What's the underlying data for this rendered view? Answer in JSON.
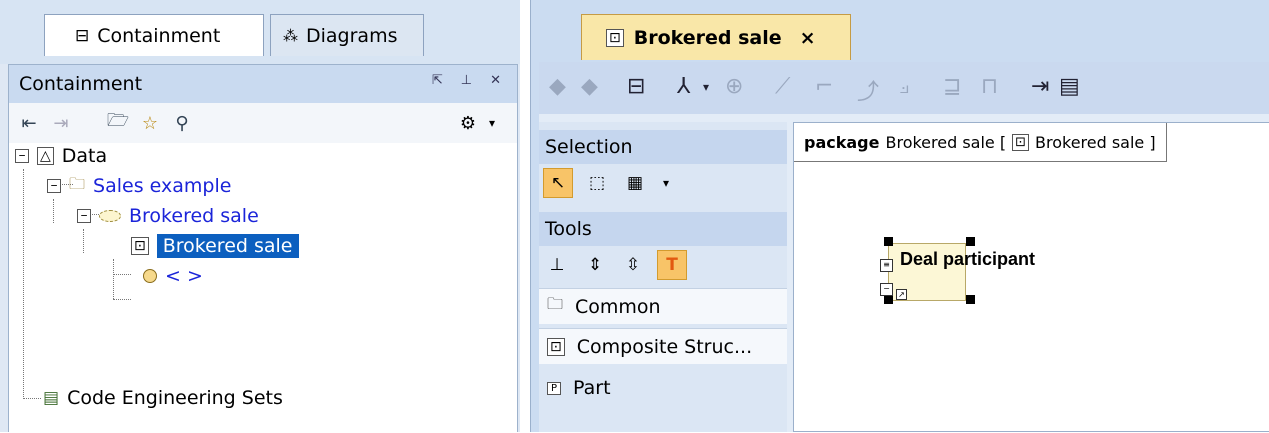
{
  "left_tabs": {
    "containment": "Containment",
    "diagrams": "Diagrams"
  },
  "panel": {
    "title": "Containment"
  },
  "tree": {
    "data": "Data",
    "sales_example": "Sales example",
    "brokered_sale_collab": "Brokered sale",
    "brokered_sale_diagram": "Brokered sale",
    "anonymous_item": "< >",
    "code_engineering_sets": "Code Engineering Sets"
  },
  "editor": {
    "tab_title": "Brokered sale",
    "close": "×"
  },
  "palette": {
    "selection": "Selection",
    "tools": "Tools",
    "common": "Common",
    "composite_structure": "Composite Struc...",
    "part": "Part"
  },
  "canvas": {
    "package_keyword": "package",
    "package_name": "Brokered sale [",
    "package_context": "Brokered sale ]",
    "part_name": "Deal participant"
  },
  "colors": {
    "selection_bg": "#0c5fbf",
    "link_blue": "#1b24d9",
    "tab_active": "#f9e7a8"
  }
}
